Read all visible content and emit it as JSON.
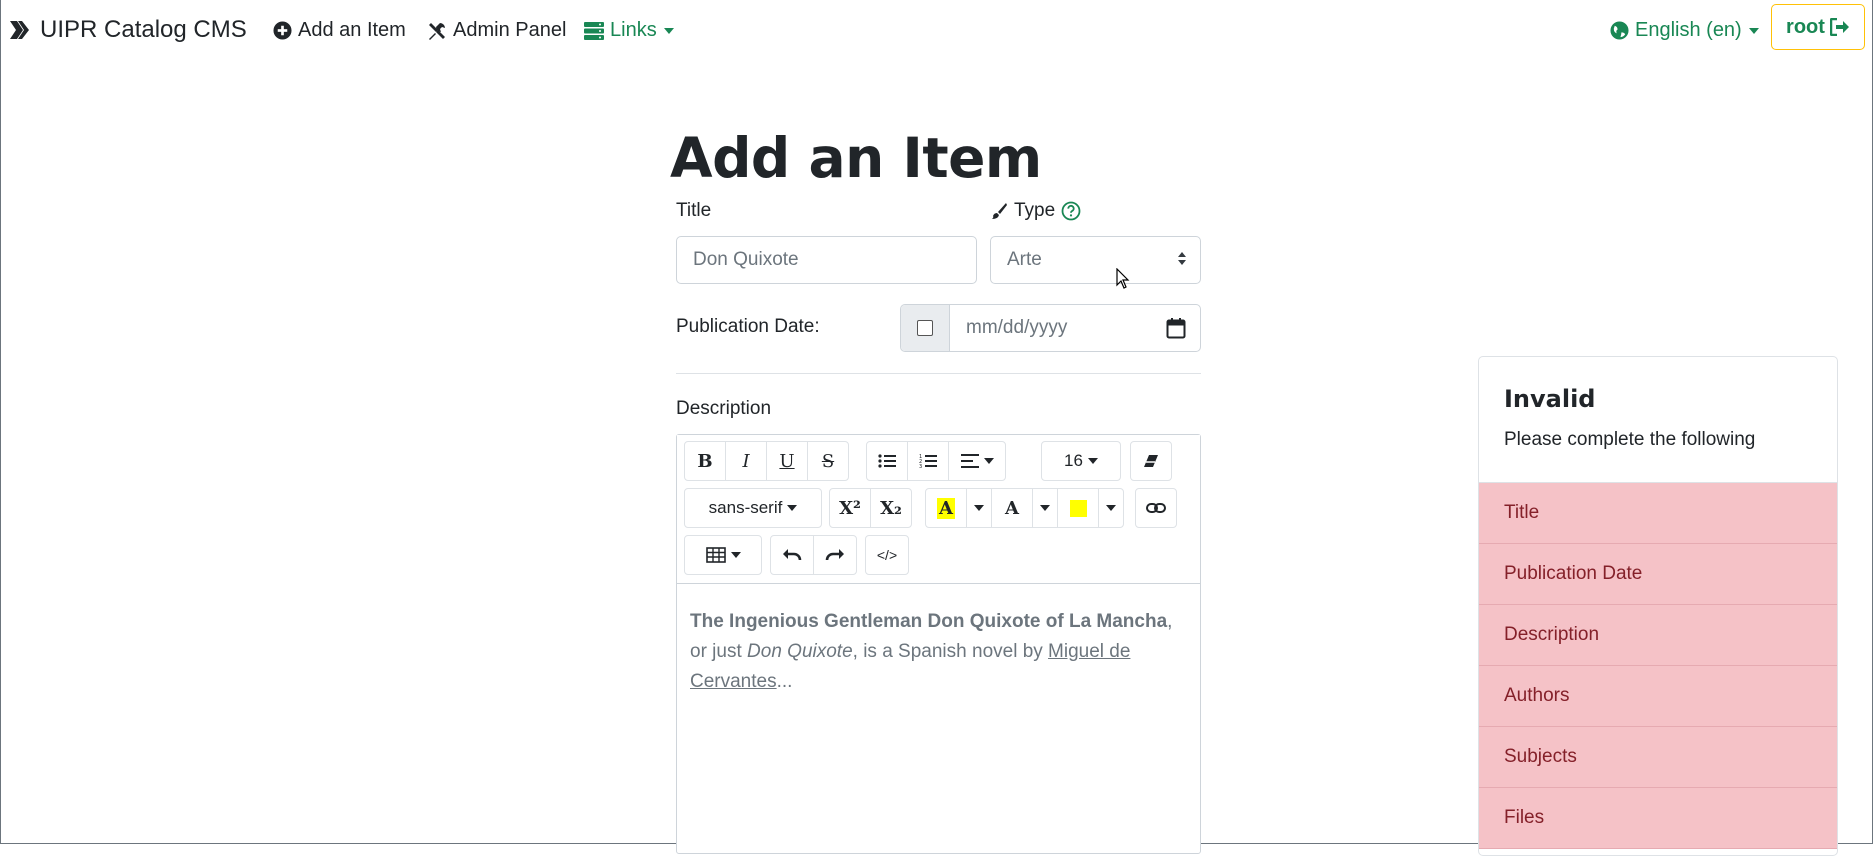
{
  "navbar": {
    "brand": "UIPR Catalog CMS",
    "add_item": "Add an Item",
    "admin_panel": "Admin Panel",
    "links": "Links",
    "language": "English (en)",
    "user": "root"
  },
  "page": {
    "title": "Add an Item"
  },
  "form": {
    "title_label": "Title",
    "title_placeholder": "Don Quixote",
    "type_label": "Type",
    "type_value": "Arte",
    "pubdate_label": "Publication Date:",
    "pubdate_placeholder": "mm/dd/yyyy",
    "description_label": "Description"
  },
  "editor": {
    "bold": "B",
    "italic": "I",
    "underline": "U",
    "strike": "S",
    "font_size": "16",
    "font_family": "sans-serif",
    "superscript": "X²",
    "subscript": "X₂",
    "fore_color_letter": "A",
    "back_color_letter": "A",
    "code_view": "</>",
    "content": {
      "bold_text": "The Ingenious Gentleman Don Quixote of La Mancha",
      "text1": ", or just ",
      "italic_text": "Don Quixote",
      "text2": ", is a Spanish novel by ",
      "link_text": "Miguel de Cervantes",
      "ellipsis": "..."
    }
  },
  "invalid_panel": {
    "title": "Invalid",
    "subtitle": "Please complete the following",
    "items": [
      "Title",
      "Publication Date",
      "Description",
      "Authors",
      "Subjects",
      "Files"
    ]
  },
  "colors": {
    "accent_green": "#198754",
    "invalid_bg": "#f5c2c7",
    "invalid_text": "#842029",
    "root_border": "#ffc107"
  }
}
